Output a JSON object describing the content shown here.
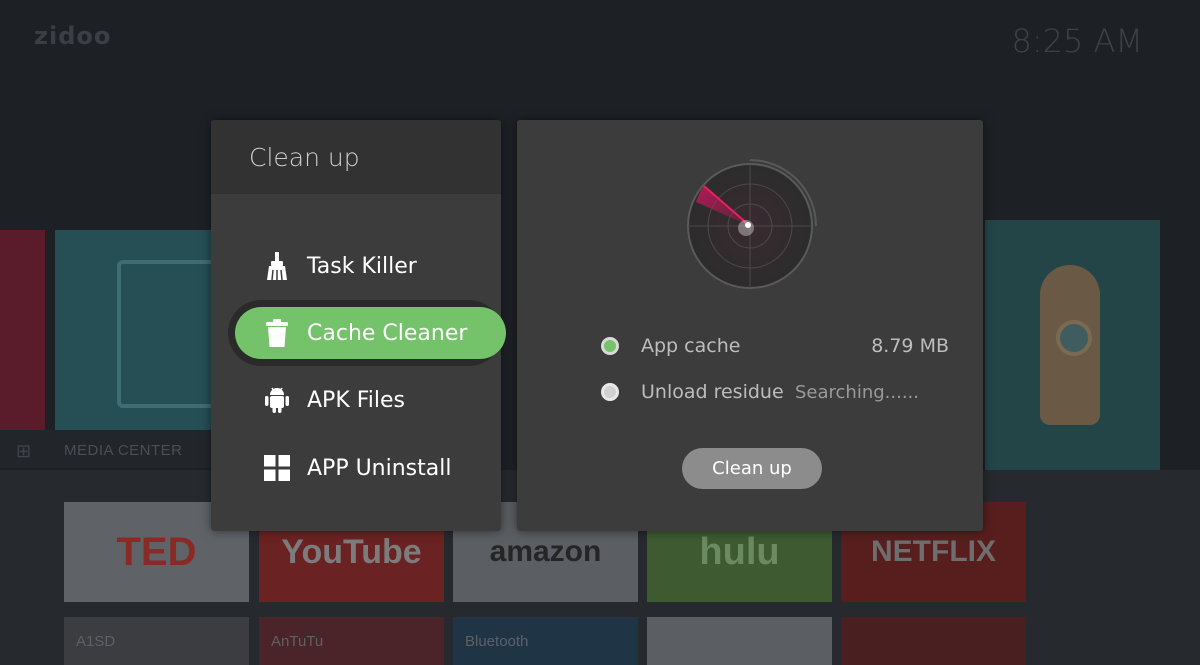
{
  "launcher": {
    "brand": "zidoo",
    "clock": "8:25 AM",
    "media_center_label": "MEDIA CENTER",
    "app_tiles": [
      "TED",
      "YouTube",
      "amazon",
      "hulu",
      "NETFLIX"
    ],
    "row2_tiles": [
      "A1SD",
      "AnTuTu",
      "Bluetooth",
      "",
      ""
    ]
  },
  "menu": {
    "title": "Clean up",
    "items": [
      {
        "label": "Task Killer",
        "icon": "broom-icon"
      },
      {
        "label": "Cache Cleaner",
        "icon": "trash-icon",
        "selected": true
      },
      {
        "label": "APK Files",
        "icon": "android-icon"
      },
      {
        "label": "APP Uninstall",
        "icon": "grid-icon"
      }
    ]
  },
  "detail": {
    "rows": [
      {
        "label": "App cache",
        "value": "8.79 MB",
        "checked": true
      },
      {
        "label": "Unload residue",
        "value": "Searching......",
        "checked": false
      }
    ],
    "button_label": "Clean up"
  },
  "colors": {
    "accent": "#74c26a",
    "panel": "#3c3c3c",
    "header": "#323232",
    "radar_sweep": "#c2185b"
  }
}
